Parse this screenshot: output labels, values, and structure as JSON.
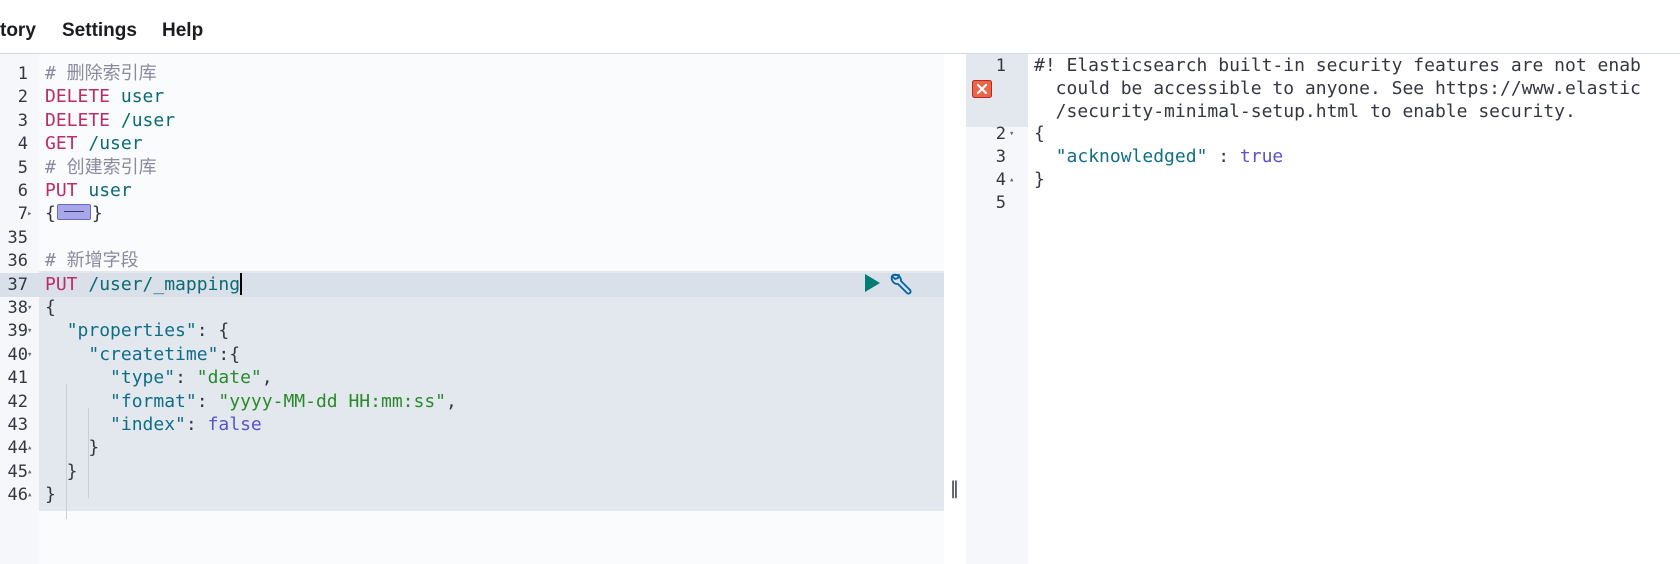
{
  "menu": {
    "history": "tory",
    "settings": "Settings",
    "help": "Help"
  },
  "editor": {
    "lines": [
      {
        "num": "1",
        "parts": [
          {
            "t": "# 删除索引库",
            "c": "cm"
          }
        ]
      },
      {
        "num": "2",
        "parts": [
          {
            "t": "DELETE",
            "c": "kw"
          },
          {
            "t": " user",
            "c": "path"
          }
        ]
      },
      {
        "num": "3",
        "parts": [
          {
            "t": "DELETE",
            "c": "kw"
          },
          {
            "t": " /user",
            "c": "path"
          }
        ]
      },
      {
        "num": "4",
        "parts": [
          {
            "t": "GET",
            "c": "kw"
          },
          {
            "t": " /user",
            "c": "path"
          }
        ]
      },
      {
        "num": "5",
        "parts": [
          {
            "t": "# 创建索引库",
            "c": "cm"
          }
        ]
      },
      {
        "num": "6",
        "parts": [
          {
            "t": "PUT",
            "c": "kw"
          },
          {
            "t": " user",
            "c": "path"
          }
        ]
      },
      {
        "num": "7",
        "fold": "right",
        "parts": [
          {
            "t": "{",
            "c": "punc"
          },
          {
            "widget": true
          },
          {
            "t": "}",
            "c": "punc"
          }
        ]
      },
      {
        "num": "35",
        "parts": []
      },
      {
        "num": "36",
        "parts": [
          {
            "t": "# 新增字段",
            "c": "cm"
          }
        ]
      },
      {
        "num": "37",
        "active": true,
        "parts": [
          {
            "t": "PUT",
            "c": "kw"
          },
          {
            "t": " /user/_mapping",
            "c": "path"
          },
          {
            "cursor": true
          }
        ]
      },
      {
        "num": "38",
        "fold": "down",
        "parts": [
          {
            "t": "{",
            "c": "punc"
          }
        ]
      },
      {
        "num": "39",
        "fold": "down",
        "parts": [
          {
            "t": "  ",
            "c": "punc"
          },
          {
            "t": "\"properties\"",
            "c": "key"
          },
          {
            "t": ": {",
            "c": "punc"
          }
        ]
      },
      {
        "num": "40",
        "fold": "down",
        "parts": [
          {
            "t": "    ",
            "c": "punc"
          },
          {
            "t": "\"createtime\"",
            "c": "key"
          },
          {
            "t": ":{",
            "c": "punc"
          }
        ]
      },
      {
        "num": "41",
        "parts": [
          {
            "t": "      ",
            "c": "punc"
          },
          {
            "t": "\"type\"",
            "c": "key"
          },
          {
            "t": ": ",
            "c": "punc"
          },
          {
            "t": "\"date\"",
            "c": "str"
          },
          {
            "t": ",",
            "c": "punc"
          }
        ]
      },
      {
        "num": "42",
        "parts": [
          {
            "t": "      ",
            "c": "punc"
          },
          {
            "t": "\"format\"",
            "c": "key"
          },
          {
            "t": ": ",
            "c": "punc"
          },
          {
            "t": "\"yyyy-MM-dd HH:mm:ss\"",
            "c": "str"
          },
          {
            "t": ",",
            "c": "punc"
          }
        ]
      },
      {
        "num": "43",
        "parts": [
          {
            "t": "      ",
            "c": "punc"
          },
          {
            "t": "\"index\"",
            "c": "key"
          },
          {
            "t": ": ",
            "c": "punc"
          },
          {
            "t": "false",
            "c": "bool"
          }
        ]
      },
      {
        "num": "44",
        "fold": "up",
        "parts": [
          {
            "t": "    }",
            "c": "punc"
          }
        ]
      },
      {
        "num": "45",
        "fold": "up",
        "parts": [
          {
            "t": "  }",
            "c": "punc"
          }
        ]
      },
      {
        "num": "46",
        "fold": "up",
        "parts": [
          {
            "t": "}",
            "c": "punc"
          }
        ]
      }
    ]
  },
  "output": {
    "lines": [
      {
        "num": "1",
        "text": "#! Elasticsearch built-in security features are not enab"
      },
      {
        "num": "",
        "text": "  could be accessible to anyone. See https://www.elastic"
      },
      {
        "num": "",
        "text": "  /security-minimal-setup.html to enable security."
      },
      {
        "num": "2",
        "fold": "down",
        "text": "{"
      },
      {
        "num": "3",
        "kv": {
          "key": "\"acknowledged\"",
          "sep": " : ",
          "val": "true"
        }
      },
      {
        "num": "4",
        "fold": "up",
        "text": "}"
      },
      {
        "num": "5",
        "text": ""
      }
    ]
  },
  "colors": {
    "keyword": "#bd2c69",
    "path": "#0b6b72",
    "comment": "#8a8a9e",
    "json_key": "#0f6e86",
    "string": "#2a8a2a",
    "boolean": "#5a52c8",
    "run_action": "#017d73"
  },
  "icons": {
    "run": "play-icon",
    "wrench": "wrench-icon",
    "error": "error-icon",
    "divider": "resize-handle-icon"
  }
}
